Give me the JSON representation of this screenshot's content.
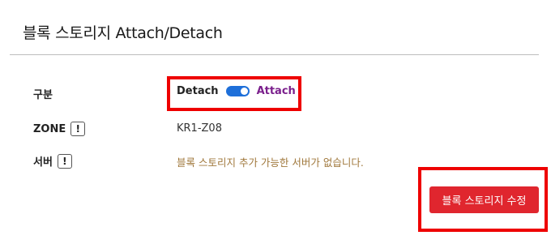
{
  "panel": {
    "title": "블록 스토리지 Attach/Detach"
  },
  "form": {
    "type_row": {
      "label": "구분",
      "off_label": "Detach",
      "on_label": "Attach",
      "state": "Attach"
    },
    "zone_row": {
      "label": "ZONE",
      "info_icon_text": "!",
      "value": "KR1-Z08"
    },
    "server_row": {
      "label": "서버",
      "info_icon_text": "!",
      "message": "블록 스토리지 추가 가능한 서버가 없습니다."
    }
  },
  "actions": {
    "submit_label": "블록 스토리지 수정"
  },
  "colors": {
    "accent": "#1e6fd9",
    "primary_button": "#e0262e",
    "warning_text": "#a0783c",
    "highlight": "#ee0000",
    "attach_label": "#7a1f8c"
  }
}
